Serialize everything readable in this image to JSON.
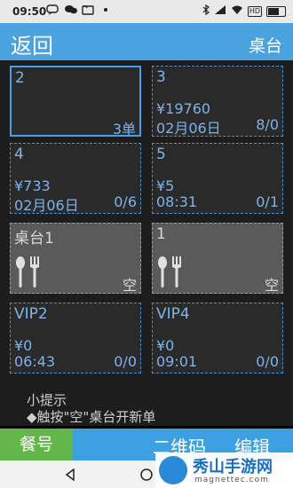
{
  "status_bar": {
    "time": "09:50",
    "left_icons": [
      "message-icon",
      "wechat-icon",
      "folder-icon",
      "dot-icon"
    ],
    "right_icons": [
      "bluetooth-icon",
      "signal-icon",
      "wifi-icon",
      "hd-icon",
      "battery-icon"
    ],
    "hd_label": "HD"
  },
  "header": {
    "back_label": "返回",
    "title": "桌台"
  },
  "tables": [
    {
      "name": "2",
      "amount": "",
      "time": "",
      "count": "",
      "orders": "3单",
      "empty": false,
      "selected": true
    },
    {
      "name": "3",
      "amount": "¥19760",
      "time": "02月06日",
      "count": "8/0",
      "orders": "",
      "empty": false,
      "selected": false
    },
    {
      "name": "4",
      "amount": "¥733",
      "time": "02月06日",
      "count": "0/6",
      "orders": "",
      "empty": false,
      "selected": false
    },
    {
      "name": "5",
      "amount": "¥5",
      "time": "08:31",
      "count": "0/1",
      "orders": "",
      "empty": false,
      "selected": false
    },
    {
      "name": "桌台1",
      "status": "空",
      "empty": true
    },
    {
      "name": "1",
      "status": "空",
      "empty": true
    },
    {
      "name": "VIP2",
      "amount": "¥0",
      "time": "06:43",
      "count": "0/0",
      "orders": "",
      "empty": false,
      "selected": false
    },
    {
      "name": "VIP4",
      "amount": "¥0",
      "time": "09:01",
      "count": "0/0",
      "orders": "",
      "empty": false,
      "selected": false
    }
  ],
  "tips": {
    "title": "小提示",
    "line1": "◆触按\"空\"桌台开新单"
  },
  "bottom": {
    "order_label": "餐号",
    "qr_label": "二维码",
    "edit_label": "编辑"
  },
  "watermark": {
    "title": "秀山手游网",
    "url": "magnettec.com"
  },
  "colors": {
    "accent": "#4aa3df",
    "order_button": "#62b64a",
    "tile_text": "#7fb3e8"
  }
}
